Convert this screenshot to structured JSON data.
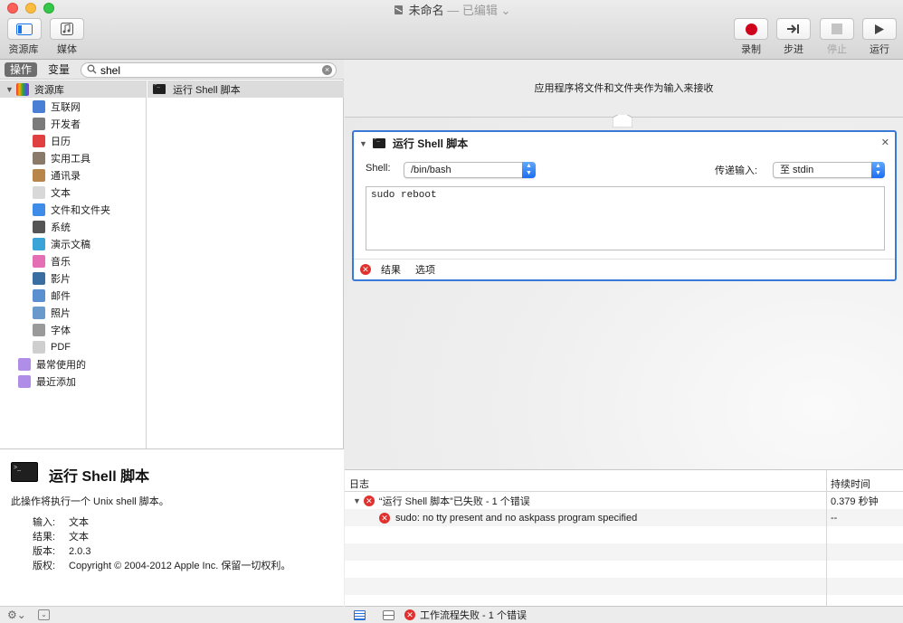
{
  "window": {
    "title": "未命名",
    "edited": "— 已编辑"
  },
  "toolbar": {
    "library_label": "资源库",
    "media_label": "媒体",
    "record_label": "录制",
    "step_label": "步进",
    "stop_label": "停止",
    "run_label": "运行"
  },
  "sidebar": {
    "tab_actions": "操作",
    "tab_variables": "变量",
    "search_value": "shel",
    "library_root": "资源库",
    "categories": [
      {
        "label": "互联网",
        "icon": "globe-icon"
      },
      {
        "label": "开发者",
        "icon": "tools-icon"
      },
      {
        "label": "日历",
        "icon": "calendar-icon"
      },
      {
        "label": "实用工具",
        "icon": "utilities-icon"
      },
      {
        "label": "通讯录",
        "icon": "contacts-icon"
      },
      {
        "label": "文本",
        "icon": "text-icon"
      },
      {
        "label": "文件和文件夹",
        "icon": "finder-icon"
      },
      {
        "label": "系统",
        "icon": "system-icon"
      },
      {
        "label": "演示文稿",
        "icon": "presentation-icon"
      },
      {
        "label": "音乐",
        "icon": "music-icon"
      },
      {
        "label": "影片",
        "icon": "movie-icon"
      },
      {
        "label": "邮件",
        "icon": "mail-icon"
      },
      {
        "label": "照片",
        "icon": "photos-icon"
      },
      {
        "label": "字体",
        "icon": "font-icon"
      },
      {
        "label": "PDF",
        "icon": "pdf-icon"
      }
    ],
    "smart_groups": [
      "最常使用的",
      "最近添加"
    ],
    "actions": [
      "运行 Shell 脚本"
    ]
  },
  "description": {
    "title": "运行 Shell 脚本",
    "text": "此操作将执行一个 Unix shell 脚本。",
    "input_key": "输入:",
    "input_val": "文本",
    "result_key": "结果:",
    "result_val": "文本",
    "version_key": "版本:",
    "version_val": "2.0.3",
    "copyright_key": "版权:",
    "copyright_val": "Copyright © 2004-2012 Apple Inc. 保留一切权利。"
  },
  "workflow": {
    "receives": "应用程序将文件和文件夹作为输入来接收",
    "action": {
      "title": "运行 Shell 脚本",
      "shell_label": "Shell:",
      "shell_value": "/bin/bash",
      "pass_input_label": "传递输入:",
      "pass_input_value": "至 stdin",
      "script": "sudo reboot",
      "results_tab": "结果",
      "options_tab": "选项"
    }
  },
  "log": {
    "col_log": "日志",
    "col_duration": "持续时间",
    "rows": [
      {
        "text": "“运行 Shell 脚本”已失败 - 1 个错误",
        "duration": "0.379 秒钟"
      },
      {
        "text": "sudo: no tty present and no askpass program specified",
        "duration": "--"
      }
    ],
    "status": "工作流程失败 - 1 个错误"
  },
  "colors": {
    "accent": "#3979d8",
    "error": "#e0312e",
    "record": "#d0021b"
  }
}
